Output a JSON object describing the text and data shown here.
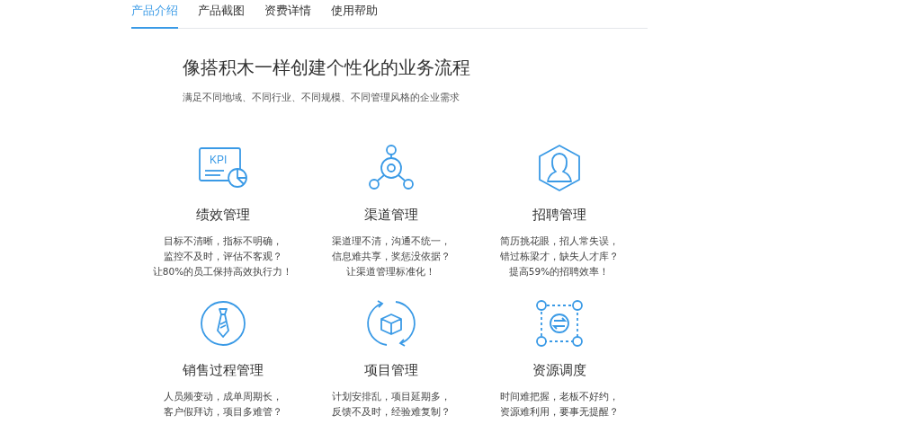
{
  "tabs": [
    {
      "label": "产品介绍",
      "selected": true
    },
    {
      "label": "产品截图",
      "selected": false
    },
    {
      "label": "资费详情",
      "selected": false
    },
    {
      "label": "使用帮助",
      "selected": false
    }
  ],
  "heading": "像搭积木一样创建个性化的业务流程",
  "subtitle": "满足不同地域、不同行业、不同规模、不同管理风格的企业需求",
  "features": [
    {
      "icon_label": "KPI",
      "title": "绩效管理",
      "lines": [
        "目标不清晰，指标不明确，",
        "监控不及时，评估不客观？",
        "让80%的员工保持高效执行力！"
      ]
    },
    {
      "title": "渠道管理",
      "lines": [
        "渠道理不清，沟通不统一，",
        "信息难共享，奖惩没依据？",
        "让渠道管理标准化！"
      ]
    },
    {
      "title": "招聘管理",
      "lines": [
        "简历挑花眼，招人常失误，",
        "错过栋梁才，缺失人才库？",
        "提高59%的招聘效率！"
      ]
    },
    {
      "title": "销售过程管理",
      "lines": [
        "人员频变动，成单周期长，",
        "客户假拜访，项目多难管？"
      ]
    },
    {
      "title": "项目管理",
      "lines": [
        "计划安排乱，项目延期多，",
        "反馈不及时，经验难复制？"
      ]
    },
    {
      "title": "资源调度",
      "lines": [
        "时间难把握，老板不好约，",
        "资源难利用，要事无提醒？"
      ]
    }
  ]
}
